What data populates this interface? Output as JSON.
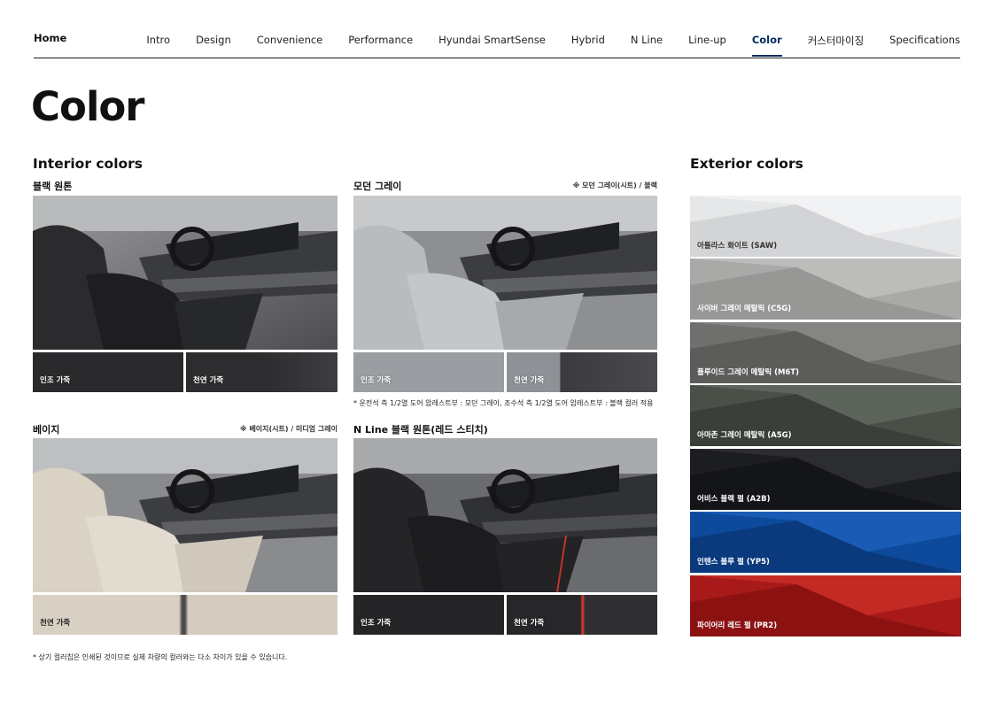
{
  "nav": {
    "home": "Home",
    "items": [
      {
        "label": "Intro",
        "active": false
      },
      {
        "label": "Design",
        "active": false
      },
      {
        "label": "Convenience",
        "active": false
      },
      {
        "label": "Performance",
        "active": false
      },
      {
        "label": "Hyundai SmartSense",
        "active": false
      },
      {
        "label": "Hybrid",
        "active": false
      },
      {
        "label": "N Line",
        "active": false
      },
      {
        "label": "Line-up",
        "active": false
      },
      {
        "label": "Color",
        "active": true
      },
      {
        "label": "커스터마이징",
        "active": false
      },
      {
        "label": "Specifications",
        "active": false
      }
    ]
  },
  "page": {
    "title": "Color",
    "interior_title": "Interior colors",
    "exterior_title": "Exterior colors",
    "footnote": "* 상기 컬러칩은 인쇄된 것이므로 실제 차량의 컬러와는 다소 차이가 있을 수 있습니다."
  },
  "interior": [
    {
      "name": "블랙 원톤",
      "note": "",
      "seat_color": "#2b2b2d",
      "swatches": [
        {
          "label": "인조 가죽",
          "color": "#2a2a2c"
        },
        {
          "label": "천연 가죽",
          "color": "#2d2d2f"
        }
      ]
    },
    {
      "name": "모던 그레이",
      "note": "※ 모던 그레이(시트) / 블랙",
      "seat_color": "#b9bcbf",
      "swatches": [
        {
          "label": "인조 가죽",
          "color": "#9a9da1"
        },
        {
          "label": "천연 가죽",
          "color": "#8e9196"
        }
      ],
      "footnote": "* 운전석 측 1/2열 도어 암레스트부 : 모던 그레이, 조수석 측 1/2열 도어 암레스트부 : 블랙 컬러 적용"
    },
    {
      "name": "베이지",
      "note": "※ 베이지(시트) / 미디엄 그레이",
      "seat_color": "#d9d2c5",
      "swatches": [
        {
          "label": "천연 가죽",
          "color": "#d8d0c3"
        }
      ]
    },
    {
      "name": "N Line 블랙 원톤(레드 스티치)",
      "note": "",
      "seat_color": "#252527",
      "swatches": [
        {
          "label": "인조 가죽",
          "color": "#252527"
        },
        {
          "label": "천연 가죽",
          "color": "#27272a"
        }
      ]
    }
  ],
  "exterior": [
    {
      "label": "아틀라스 화이트 (SAW)",
      "color": "#e6e7e8",
      "light": true
    },
    {
      "label": "사이버 그레이 메탈릭 (C5G)",
      "color": "#a9aaa8",
      "light": false
    },
    {
      "label": "플루이드 그레이 메탈릭 (M6T)",
      "color": "#6f706d",
      "light": false
    },
    {
      "label": "아마존 그레이 메탈릭 (A5G)",
      "color": "#4a5048",
      "light": false
    },
    {
      "label": "어비스 블랙 펄 (A2B)",
      "color": "#1c1d20",
      "light": false
    },
    {
      "label": "인텐스 블루 펄 (YP5)",
      "color": "#0d4a9c",
      "light": false
    },
    {
      "label": "파이어리 레드 펄 (PR2)",
      "color": "#a81a1a",
      "light": false
    }
  ]
}
